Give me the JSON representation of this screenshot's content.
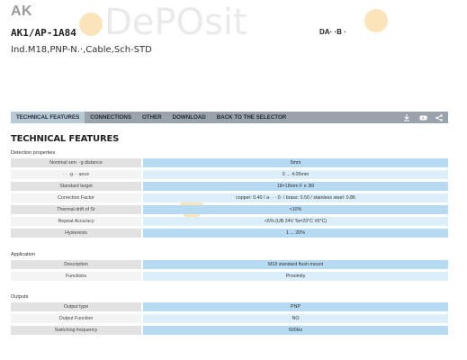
{
  "header": {
    "brand": "AK",
    "model": "AK1/AP-1A84",
    "description": "Ind.M18,PNP-N.·,Cable,Sch-STD",
    "date_label": "DA·   ·B ·"
  },
  "watermark": {
    "text": "DePOsit"
  },
  "tabs": [
    {
      "label": "TECHNICAL FEATURES",
      "active": true
    },
    {
      "label": "CONNECTIONS"
    },
    {
      "label": "OTHER"
    },
    {
      "label": "DOWNLOAD"
    },
    {
      "label": "BACK TO THE SELECTOR"
    }
  ],
  "tab_icons": [
    "download-icon",
    "youtube-icon",
    "share-icon"
  ],
  "section_title": "TECHNICAL FEATURES",
  "sections": {
    "detection": {
      "label": "Detection properties",
      "rows": [
        {
          "key": "Nominal sen·  ·g distance",
          "value": "5mm"
        },
        {
          "key": "·  ·  ·g ·  ·ance",
          "value": "0 ... 4.05mm"
        },
        {
          "key": "Standard target",
          "value": "18×18mm F e 36l"
        },
        {
          "key": "Correction Factor",
          "value": "copper: 0.40 / a·  ·  ·  0·  / brass: 0.50 / stainless steel: 0.86"
        },
        {
          "key": "Thermal drift of Sr",
          "value": "<10%"
        },
        {
          "key": "Repeat Accuracy",
          "value": "<5% (UB 24V Ta=23°C ±5°C)"
        },
        {
          "key": "Hysteresis",
          "value": "1 ... 20%"
        }
      ]
    },
    "application": {
      "label": "Application",
      "rows": [
        {
          "key": "Description",
          "value": "M18 standard flush mount"
        },
        {
          "key": "Functions",
          "value": "Proximity"
        }
      ]
    },
    "outputs": {
      "label": "Outputs",
      "rows": [
        {
          "key": "Output type",
          "value": "PNP"
        },
        {
          "key": "Output Function",
          "value": "NO"
        },
        {
          "key": "Switching frequency",
          "value": "600Hz"
        }
      ]
    }
  }
}
